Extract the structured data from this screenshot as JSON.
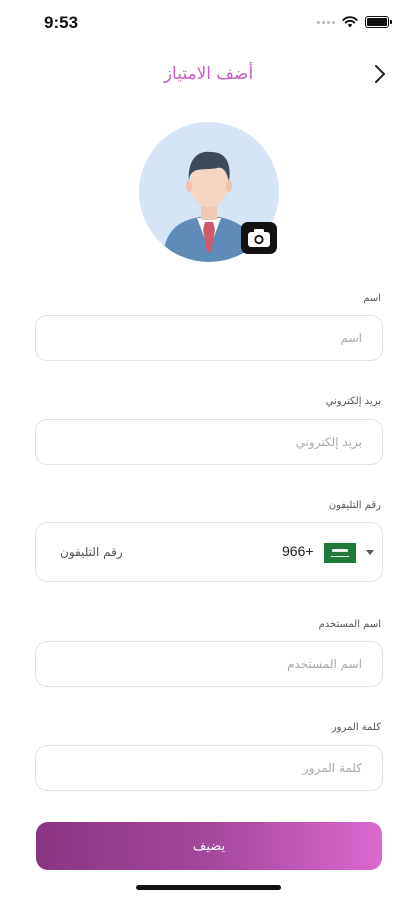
{
  "status_bar": {
    "time": "9:53",
    "icons": [
      "signal-dots-icon",
      "wifi-icon",
      "battery-icon"
    ]
  },
  "header": {
    "title": "أضف الامتياز",
    "back_icon": "chevron-right-icon"
  },
  "avatar": {
    "icon": "user-avatar-icon",
    "camera_icon": "camera-icon"
  },
  "form": {
    "name": {
      "label": "اسم",
      "placeholder": "اسم",
      "value": ""
    },
    "email": {
      "label": "بريد إلكتروني",
      "placeholder": "بريد إلكتروني",
      "value": ""
    },
    "phone": {
      "label": "رقم التليفون",
      "placeholder": "رقم التليفون",
      "country_code": "966+",
      "flag_icon": "saudi-flag-icon",
      "dropdown_icon": "caret-down-icon"
    },
    "username": {
      "label": "اسم المستخدم",
      "placeholder": "اسم المستخدم",
      "value": ""
    },
    "password": {
      "label": "كلمة المرور",
      "placeholder": "كلمة المرور",
      "value": ""
    }
  },
  "submit": {
    "label": "يضيف"
  },
  "colors": {
    "accent": "#c95fc4",
    "button_gradient_start": "#8a3581",
    "button_gradient_end": "#dc68d0",
    "field_border": "#e1e1e1"
  }
}
